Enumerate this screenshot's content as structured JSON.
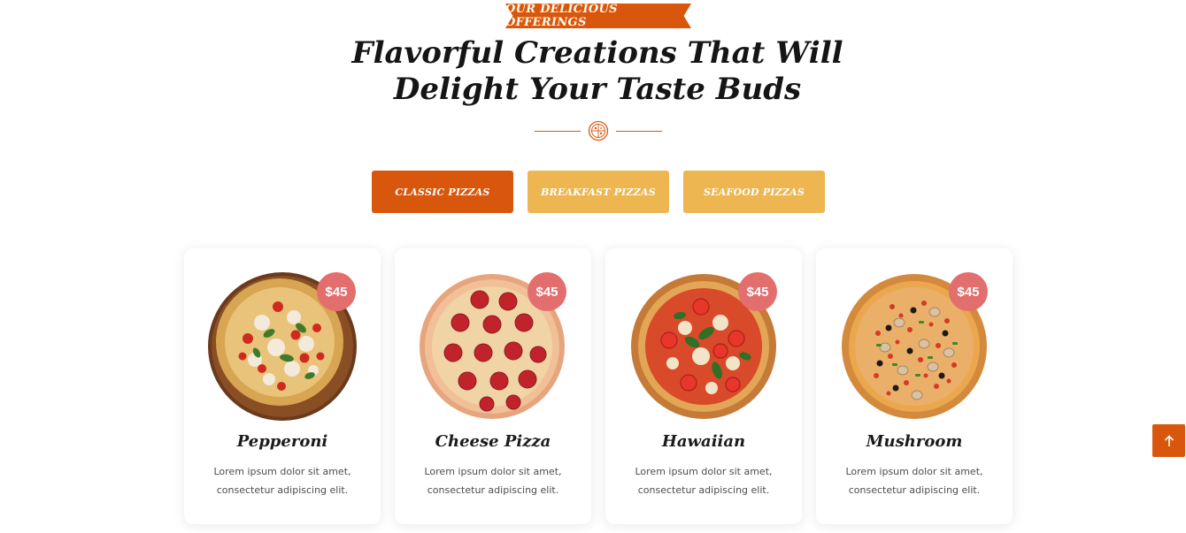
{
  "section": {
    "eyebrow": "OUR DELICIOUS OFFERINGS",
    "title_line1": "Flavorful Creations That Will",
    "title_line2": "Delight Your Taste Buds",
    "divider_icon": "pizza-icon"
  },
  "tabs": [
    {
      "label": "CLASSIC PIZZAS",
      "active": true
    },
    {
      "label": "BREAKFAST PIZZAS",
      "active": false
    },
    {
      "label": "SEAFOOD PIZZAS",
      "active": false
    }
  ],
  "items": [
    {
      "name": "Pepperoni",
      "price": "$45",
      "description": "Lorem ipsum dolor sit amet, consectetur adipiscing elit.",
      "image": "margherita-pizza-on-wooden-board"
    },
    {
      "name": "Cheese Pizza",
      "price": "$45",
      "description": "Lorem ipsum dolor sit amet, consectetur adipiscing elit.",
      "image": "pepperoni-pizza"
    },
    {
      "name": "Hawaiian",
      "price": "$45",
      "description": "Lorem ipsum dolor sit amet, consectetur adipiscing elit.",
      "image": "tomato-basil-pizza"
    },
    {
      "name": "Mushroom",
      "price": "$45",
      "description": "Lorem ipsum dolor sit amet, consectetur adipiscing elit.",
      "image": "mushroom-olive-pizza"
    }
  ],
  "scroll_top": {
    "icon": "arrow-up-icon"
  },
  "colors": {
    "accent": "#d9570c",
    "tab_inactive": "#edb651",
    "price_badge": "#e36e6e",
    "heading": "#151515"
  }
}
